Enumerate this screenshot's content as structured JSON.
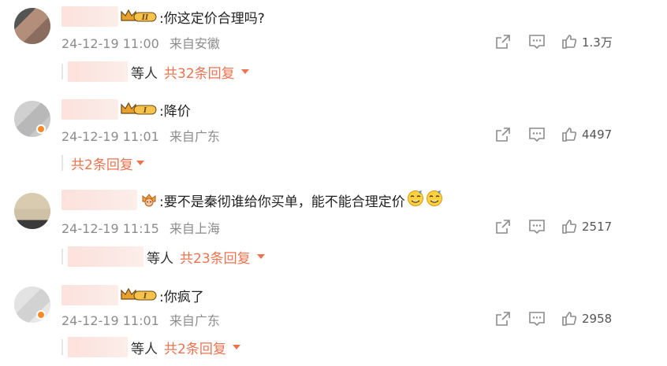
{
  "comments": [
    {
      "text": ":你这定价合理吗?",
      "time": "24-12-19 11:00",
      "location": "来自安徽",
      "likes": "1.3万",
      "reply_others": "等人",
      "reply_count": "共32条回复",
      "badge": "crown-level-2-icon"
    },
    {
      "text": ":降价",
      "time": "24-12-19 11:01",
      "location": "来自广东",
      "likes": "4497",
      "reply_others": "",
      "reply_count": "共2条回复",
      "badge": "crown-level-1-icon"
    },
    {
      "text": ":要不是秦彻谁给你买单，能不能合理定价",
      "time": "24-12-19 11:15",
      "location": "来自上海",
      "likes": "2517",
      "reply_others": "等人",
      "reply_count": "共23条回复",
      "badge": "fan-badge-icon"
    },
    {
      "text": ":你疯了",
      "time": "24-12-19 11:01",
      "location": "来自广东",
      "likes": "2958",
      "reply_others": "等人",
      "reply_count": "共2条回复",
      "badge": "crown-level-1-icon"
    }
  ],
  "colors": {
    "accent": "#eb7350",
    "meta": "#8c8c8c",
    "crown_gold": "#e9a12b",
    "crown_dark": "#6b4a1c"
  }
}
